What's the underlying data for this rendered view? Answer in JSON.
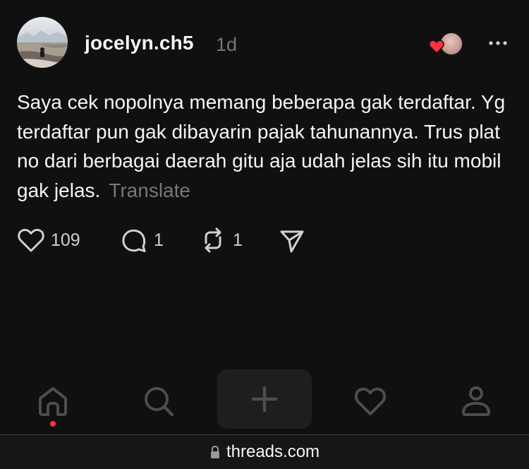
{
  "post": {
    "username": "jocelyn.ch5",
    "time": "1d",
    "body": "Saya cek nopolnya memang beberapa gak terdaftar. Yg terdaftar pun gak dibayarin pajak tahunannya. Trus plat no dari berbagai daerah gitu aja udah jelas sih itu mobil gak jelas.",
    "translate_label": "Translate",
    "actions": {
      "likes": "109",
      "replies": "1",
      "reposts": "1"
    },
    "icons": {
      "avatar": "user-avatar-landscape",
      "liked_by": "heart-badge-avatar",
      "more": "more-horizontal-icon",
      "like": "heart-icon",
      "reply": "comment-icon",
      "repost": "repost-icon",
      "share": "send-icon"
    }
  },
  "tabbar": {
    "icons": [
      "home-icon",
      "search-icon",
      "plus-icon",
      "heart-icon",
      "profile-icon"
    ],
    "active": "home",
    "notification_color": "#ff3040"
  },
  "browser": {
    "url": "threads.com",
    "lock_icon": "lock-icon"
  },
  "colors": {
    "background": "#101010",
    "text": "#f3f5f7",
    "muted": "#777777",
    "like_red": "#ff3040"
  }
}
